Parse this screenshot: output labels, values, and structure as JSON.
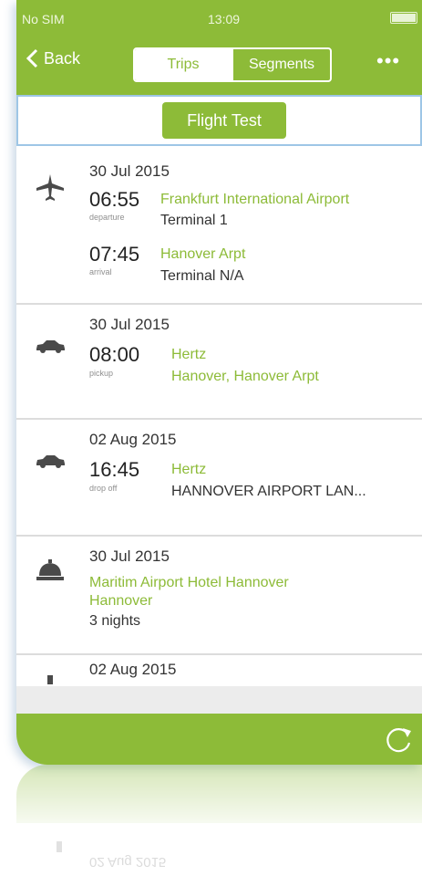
{
  "statusbar": {
    "carrier": "No SIM",
    "time": "13:09"
  },
  "navbar": {
    "back_label": "Back",
    "tabs": [
      "Trips",
      "Segments"
    ],
    "more_label": "•••"
  },
  "filter": {
    "label": "Flight Test"
  },
  "items": [
    {
      "type": "flight",
      "date": "30 Jul 2015",
      "time1": "06:55",
      "label1": "departure",
      "place1": "Frankfurt International Airport",
      "detail1": "Terminal 1",
      "time2": "07:45",
      "label2": "arrival",
      "place2": "Hanover Arpt",
      "detail2": "Terminal N/A"
    },
    {
      "type": "car",
      "date": "30 Jul 2015",
      "time": "08:00",
      "label": "pickup",
      "company": "Hertz",
      "location": "Hanover, Hanover Arpt"
    },
    {
      "type": "car",
      "date": "02 Aug 2015",
      "time": "16:45",
      "label": "drop off",
      "company": "Hertz",
      "location": "HANNOVER AIRPORT LAN..."
    },
    {
      "type": "hotel",
      "date": "30 Jul 2015",
      "name": "Maritim Airport Hotel Hannover",
      "city": "Hannover",
      "nights": "3 nights"
    },
    {
      "type": "hotel",
      "date": "02 Aug 2015"
    }
  ],
  "reflection": {
    "date": "02 Aug 2015"
  },
  "colors": {
    "accent": "#8dbb38",
    "divider": "#dcdcdc",
    "focus_border": "#9ec6e6"
  },
  "icons": [
    "back-chevron-icon",
    "airplane-icon",
    "car-icon",
    "hotel-bell-icon",
    "refresh-icon"
  ]
}
